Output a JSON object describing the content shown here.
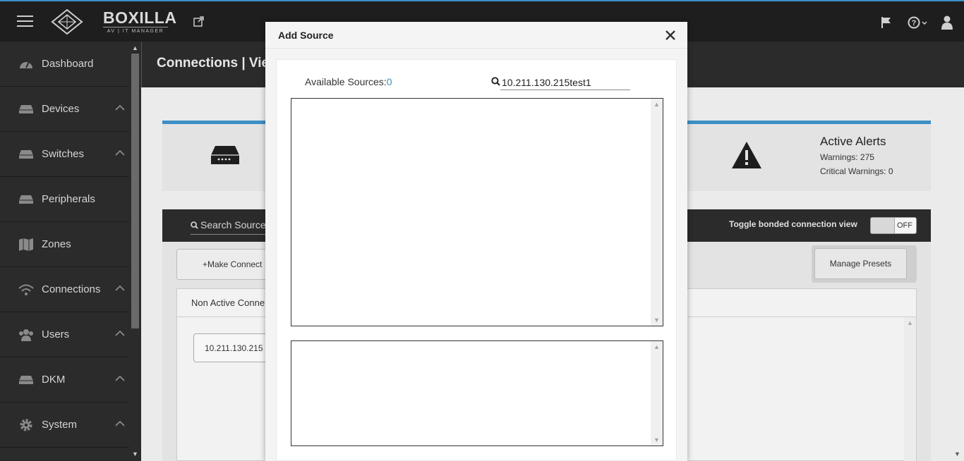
{
  "header": {
    "brand_name": "BOXILLA",
    "brand_sub": "AV | IT MANAGER"
  },
  "sidebar": {
    "items": [
      {
        "label": "Dashboard",
        "icon": "dashboard-icon"
      },
      {
        "label": "Devices",
        "icon": "device-icon"
      },
      {
        "label": "Switches",
        "icon": "switch-icon"
      },
      {
        "label": "Peripherals",
        "icon": "peripheral-icon"
      },
      {
        "label": "Zones",
        "icon": "map-icon"
      },
      {
        "label": "Connections",
        "icon": "wifi-icon"
      },
      {
        "label": "Users",
        "icon": "users-icon"
      },
      {
        "label": "DKM",
        "icon": "dkm-icon"
      },
      {
        "label": "System",
        "icon": "gear-icon"
      }
    ]
  },
  "page": {
    "title": "Connections | Vie",
    "alerts_title": "Active Alerts",
    "alerts_warnings": "Warnings: 275",
    "alerts_critical": "Critical Warnings: 0",
    "search_sources": "Search Sources",
    "toggle_label": "Toggle bonded connection view",
    "toggle_state": "OFF",
    "make_connection": "+Make Connect",
    "manage_presets": "Manage Presets",
    "non_active_tab": "Non Active Conne",
    "connection_chip": "10.211.130.215"
  },
  "modal": {
    "title": "Add Source",
    "available_label": "Available Sources:",
    "available_count": "0",
    "search_value": "10.211.130.215test1"
  },
  "colors": {
    "accent": "#3d8fc6",
    "topbar": "#1e1e1e",
    "sidebar": "#2b2b2b"
  }
}
